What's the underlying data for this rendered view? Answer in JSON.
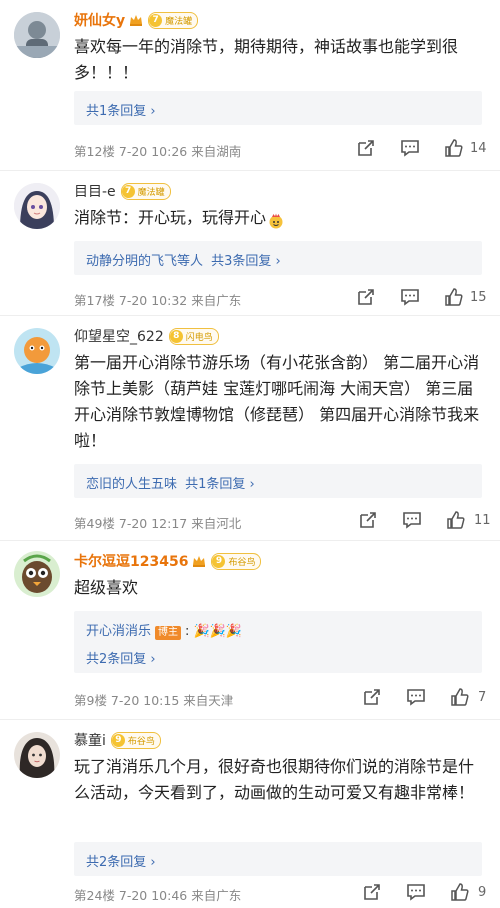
{
  "comments": [
    {
      "username": "妍仙女y",
      "badge": "魔法罐",
      "level": "7",
      "text": "喜欢每一年的消除节，期待期待，神话故事也能学到很多！！！",
      "replies_link": "共1条回复 ›",
      "meta": "第12楼  7-20 10:26  来自湖南",
      "likes": "14"
    },
    {
      "username": "目目-e",
      "badge": "魔法罐",
      "level": "7",
      "text": "消除节：开心玩，玩得开心",
      "reply_users": "动静分明的飞飞等人",
      "replies_link": "共3条回复 ›",
      "meta": "第17楼  7-20 10:32  来自广东",
      "likes": "15"
    },
    {
      "username": "仰望星空_622",
      "badge": "闪电鸟",
      "level": "8",
      "text": "第一届开心消除节游乐场（有小花张含韵） 第二届开心消除节上美影（葫芦娃 宝莲灯哪吒闹海 大闹天宫） 第三届开心消除节敦煌博物馆（修琵琶） 第四届开心消除节我来啦！",
      "reply_users": "恋旧的人生五味",
      "replies_link": "共1条回复 ›",
      "meta": "第49楼  7-20 12:17  来自河北",
      "likes": "11"
    },
    {
      "username": "卡尔逗逗123456",
      "badge": "布谷鸟",
      "level": "9",
      "text": "超级喜欢",
      "reply_author": "开心消消乐",
      "author_tag": "博主",
      "reply_text": ": 🎉🎉🎉",
      "replies_link": "共2条回复 ›",
      "meta": "第9楼  7-20 10:15  来自天津",
      "likes": "7"
    },
    {
      "username": "慕童i",
      "badge": "布谷鸟",
      "level": "9",
      "text": "玩了消消乐几个月，很好奇也很期待你们说的消除节是什么活动，今天看到了，动画做的生动可爱又有趣非常棒！",
      "replies_link": "共2条回复 ›",
      "meta": "第24楼  7-20 10:46  来自广东",
      "likes": "9"
    }
  ],
  "colors": {
    "username": "#e8740b",
    "link": "#3d6bb0",
    "meta": "#888888",
    "reply_bg": "#f4f5f7"
  },
  "icons": [
    "crown-icon",
    "share-icon",
    "comment-icon",
    "like-icon"
  ]
}
